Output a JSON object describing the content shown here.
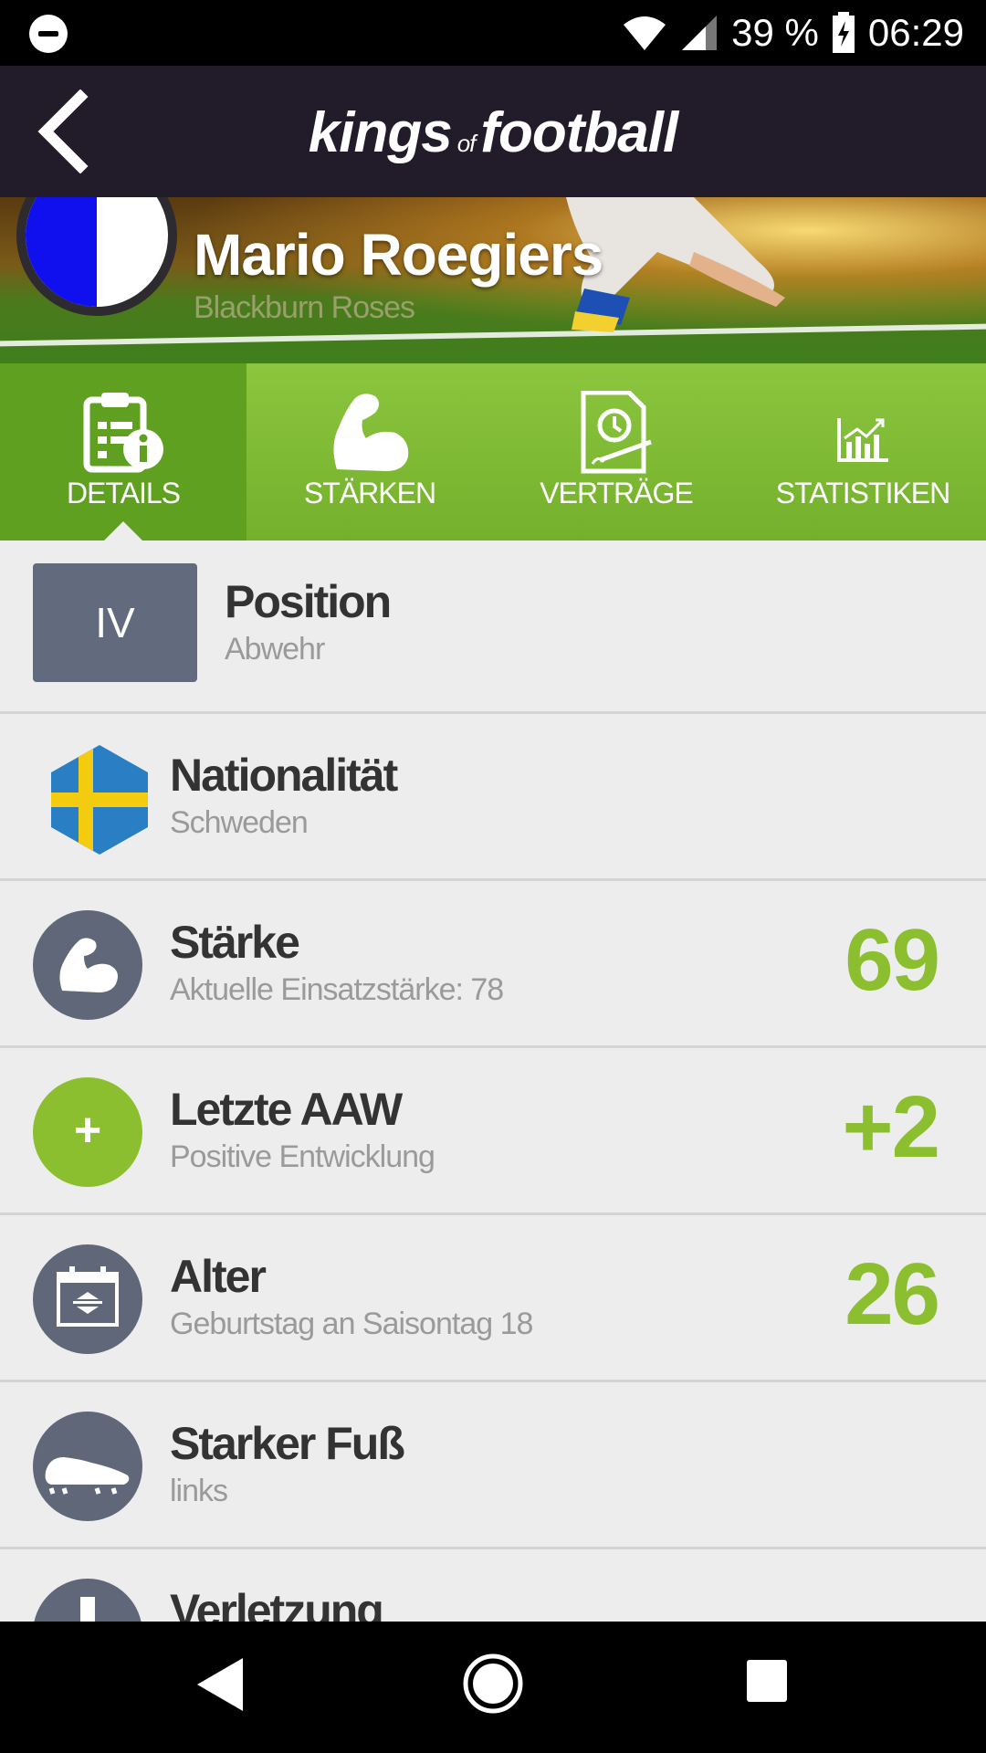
{
  "status_bar": {
    "battery": "39 %",
    "time": "06:29"
  },
  "app": {
    "logo_part1": "kings",
    "logo_of": "of",
    "logo_part2": "football"
  },
  "player": {
    "name": "Mario Roegiers",
    "club": "Blackburn Roses"
  },
  "tabs": [
    {
      "label": "DETAILS",
      "icon": "clipboard-info-icon",
      "active": true
    },
    {
      "label": "STÄRKEN",
      "icon": "biceps-icon",
      "active": false
    },
    {
      "label": "VERTRÄGE",
      "icon": "contract-icon",
      "active": false
    },
    {
      "label": "STATISTIKEN",
      "icon": "chart-icon",
      "active": false
    }
  ],
  "details": {
    "position": {
      "badge": "IV",
      "title": "Position",
      "sub": "Abwehr"
    },
    "nationality": {
      "title": "Nationalität",
      "sub": "Schweden",
      "icon": "sweden-flag-icon"
    },
    "strength": {
      "title": "Stärke",
      "sub": "Aktuelle Einsatzstärke: 78",
      "value": "69",
      "icon": "biceps-icon"
    },
    "last_aaw": {
      "badge": "+",
      "title": "Letzte AAW",
      "sub": "Positive Entwicklung",
      "value": "+2"
    },
    "age": {
      "title": "Alter",
      "sub": "Geburtstag an Saisontag 18",
      "value": "26",
      "icon": "calendar-icon"
    },
    "foot": {
      "title": "Starker Fuß",
      "sub": "links",
      "icon": "football-boot-icon"
    },
    "injury": {
      "title": "Verletzung",
      "icon": "alert-icon"
    }
  },
  "colors": {
    "accent_green": "#8cbf2f",
    "appbar": "#221b29",
    "icon_gray": "#5f6779"
  }
}
